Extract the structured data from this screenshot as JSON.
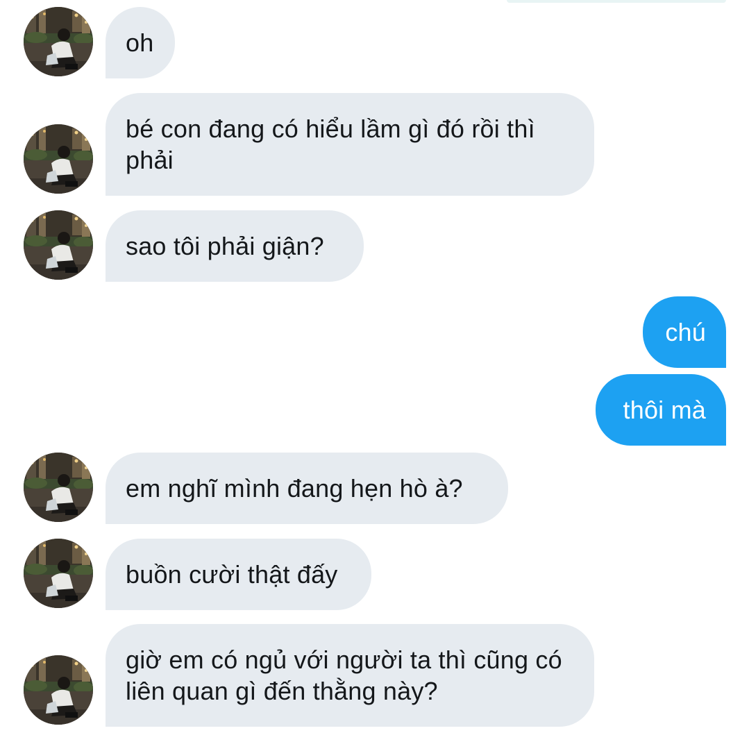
{
  "conversation": {
    "messages": [
      {
        "sender": "other",
        "text": "oh"
      },
      {
        "sender": "other",
        "text": "bé con đang có hiểu lầm gì đó rồi thì phải"
      },
      {
        "sender": "other",
        "text": "sao tôi phải giận?"
      },
      {
        "sender": "me",
        "text": "chú"
      },
      {
        "sender": "me",
        "text": "thôi mà"
      },
      {
        "sender": "other",
        "text": "em nghĩ mình đang hẹn hò à?"
      },
      {
        "sender": "other",
        "text": "buồn cười thật đấy"
      },
      {
        "sender": "other",
        "text": "giờ em có ngủ với người ta thì cũng có liên quan gì đến thằng này?"
      }
    ]
  },
  "colors": {
    "incoming_bubble": "#e6ebf0",
    "outgoing_bubble": "#1da1f2",
    "incoming_text": "#14171a",
    "outgoing_text": "#ffffff"
  },
  "icons": {
    "contact_avatar": "avatar-photo"
  }
}
